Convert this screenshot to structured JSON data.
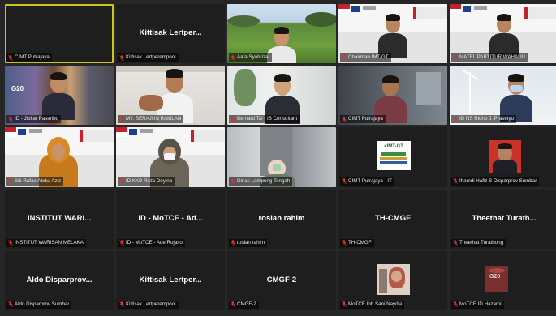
{
  "tiles": [
    {
      "name": "CIMT Putrajaya",
      "type": "dark",
      "active": true,
      "scene": "none"
    },
    {
      "name": "Kittisak Lertperempool",
      "display": "Kittisak Lertper...",
      "type": "text",
      "scene": "none"
    },
    {
      "name": "Aafa Syahrizal",
      "type": "video",
      "scene": "field"
    },
    {
      "name": "Chairman IMT-GT",
      "type": "video",
      "scene": "banner"
    },
    {
      "name": "MATEL PARTITUR WAHAUU",
      "type": "video",
      "scene": "banner"
    },
    {
      "name": "ID - Jibliar Pasaribu",
      "type": "video",
      "scene": "g20"
    },
    {
      "name": "MY. SERAJUN RAMLAN",
      "type": "video",
      "scene": "office"
    },
    {
      "name": "Bernard Tai - IB Consultant",
      "type": "video",
      "scene": "window"
    },
    {
      "name": "CIMT Putrajaya",
      "type": "video",
      "scene": "office2"
    },
    {
      "name": "ID NS Ridho J. Prasetyo",
      "type": "video",
      "scene": "windmill"
    },
    {
      "name": "Siti Rafae Abdul Aziz",
      "type": "video",
      "scene": "banner-hijab"
    },
    {
      "name": "ID KKB Rista Deyina",
      "type": "video",
      "scene": "banner-mask"
    },
    {
      "name": "Dinas Lampung Tengah",
      "type": "video",
      "scene": "street"
    },
    {
      "name": "CIMT Putrajaya - IT",
      "type": "logo",
      "scene": "imtgt"
    },
    {
      "name": "Ihamdi Hafiz S Disparprov Sumbar",
      "type": "photo",
      "scene": "portrait"
    },
    {
      "name": "INSTITUT WARISAN MELAKA",
      "display": "INSTITUT WARI...",
      "type": "text",
      "scene": "none"
    },
    {
      "name": "ID - MoTCE - Ade Rojaso",
      "display": "ID - MoTCE - Ad...",
      "type": "text",
      "scene": "none"
    },
    {
      "name": "roslan rahim",
      "display": "roslan rahim",
      "type": "text",
      "scene": "none"
    },
    {
      "name": "TH-CMGF",
      "display": "TH-CMGF",
      "type": "text",
      "scene": "none"
    },
    {
      "name": "Theethat Turathong",
      "display": "Theethat Turath...",
      "type": "text",
      "scene": "none"
    },
    {
      "name": "Aldo Disparprov Sumbar",
      "display": "Aldo Disparprov...",
      "type": "text",
      "scene": "none"
    },
    {
      "name": "Kittisak Lertperempool",
      "display": "Kittisak Lertper...",
      "type": "text",
      "scene": "none"
    },
    {
      "name": "CMGF-2",
      "display": "CMGF-2",
      "type": "text",
      "scene": "none"
    },
    {
      "name": "MoTCE Ibh Sani Naydia",
      "type": "photo",
      "scene": "thumb-person"
    },
    {
      "name": "MoTCE ID Hazami",
      "type": "photo",
      "scene": "thumb-g20"
    }
  ],
  "colors": {
    "active_outline": "#c9c51a",
    "mic_muted": "#e0322b",
    "tile_bg": "#1e1e1e"
  }
}
